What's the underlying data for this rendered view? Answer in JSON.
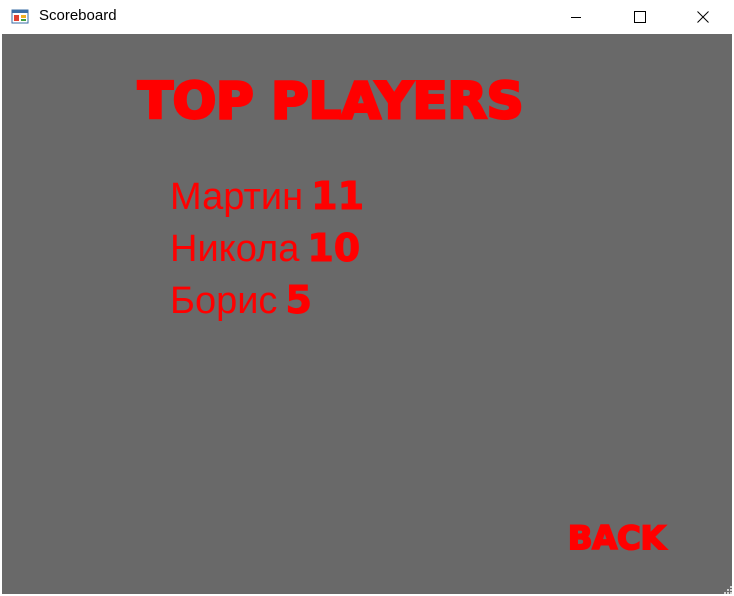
{
  "window": {
    "title": "Scoreboard",
    "icon": "winforms-app-icon",
    "controls": {
      "minimize_icon": "minimize-icon",
      "maximize_icon": "maximize-icon",
      "close_icon": "close-icon"
    }
  },
  "colors": {
    "background": "#696969",
    "accent": "#ff0000",
    "titlebar": "#ffffff"
  },
  "scoreboard": {
    "heading": "TOP PLAYERS",
    "players": [
      {
        "name": "Мартин",
        "score": "11"
      },
      {
        "name": "Никола",
        "score": "10"
      },
      {
        "name": "Борис",
        "score": "5"
      }
    ],
    "back_label": "BACK"
  }
}
